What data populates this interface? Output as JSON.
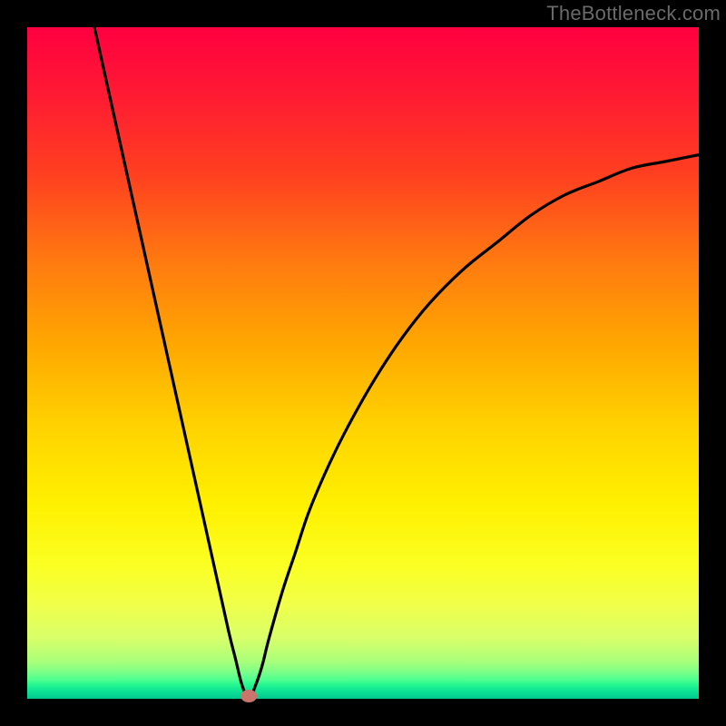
{
  "watermark": "TheBottleneck.com",
  "chart_data": {
    "type": "line",
    "title": "",
    "xlabel": "",
    "ylabel": "",
    "xlim": [
      0,
      100
    ],
    "ylim": [
      0,
      100
    ],
    "grid": false,
    "series": [
      {
        "name": "bottleneck-curve",
        "x": [
          10,
          12,
          14,
          16,
          18,
          20,
          22,
          24,
          26,
          28,
          30,
          31,
          32,
          33,
          34,
          35,
          36,
          38,
          40,
          42,
          45,
          48,
          52,
          56,
          60,
          65,
          70,
          75,
          80,
          85,
          90,
          95,
          100
        ],
        "values": [
          100,
          91,
          82,
          73,
          64,
          55,
          46,
          37,
          28,
          19,
          10,
          6,
          2,
          0,
          2,
          5,
          9,
          16,
          22,
          28,
          35,
          41,
          48,
          54,
          59,
          64,
          68,
          72,
          75,
          77,
          79,
          80,
          81
        ]
      }
    ],
    "annotations": [
      {
        "name": "min-point",
        "x": 33,
        "y": 0
      }
    ],
    "background": {
      "type": "vertical-gradient",
      "stops": [
        {
          "pos": 0.0,
          "color": "#ff0040"
        },
        {
          "pos": 0.35,
          "color": "#ff7a10"
        },
        {
          "pos": 0.6,
          "color": "#ffd400"
        },
        {
          "pos": 0.8,
          "color": "#fbff22"
        },
        {
          "pos": 0.95,
          "color": "#a8ff7a"
        },
        {
          "pos": 1.0,
          "color": "#00c890"
        }
      ]
    }
  }
}
